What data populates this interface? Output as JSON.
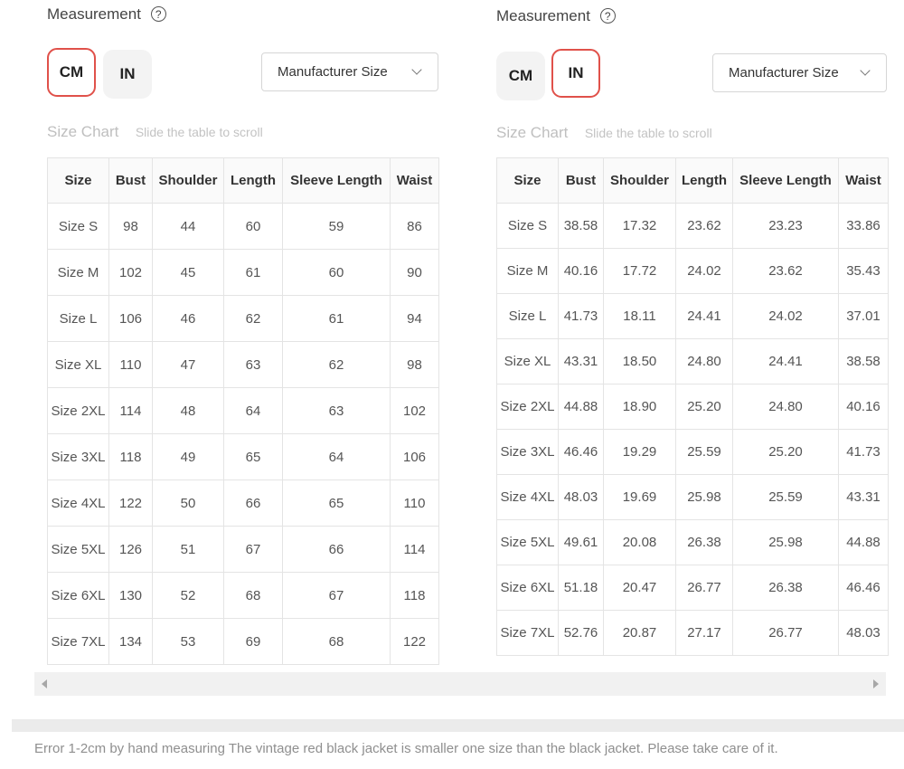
{
  "panels": [
    {
      "measurement_title": "Measurement",
      "help_icon": "?",
      "units": {
        "cm": "CM",
        "in": "IN",
        "active": "cm"
      },
      "size_select": "Manufacturer Size",
      "chart_title": "Size Chart",
      "chart_hint": "Slide the table to scroll",
      "headers": [
        "Size",
        "Bust",
        "Shoulder",
        "Length",
        "Sleeve Length",
        "Waist"
      ],
      "rows": [
        [
          "Size S",
          "98",
          "44",
          "60",
          "59",
          "86"
        ],
        [
          "Size M",
          "102",
          "45",
          "61",
          "60",
          "90"
        ],
        [
          "Size L",
          "106",
          "46",
          "62",
          "61",
          "94"
        ],
        [
          "Size XL",
          "110",
          "47",
          "63",
          "62",
          "98"
        ],
        [
          "Size 2XL",
          "114",
          "48",
          "64",
          "63",
          "102"
        ],
        [
          "Size 3XL",
          "118",
          "49",
          "65",
          "64",
          "106"
        ],
        [
          "Size 4XL",
          "122",
          "50",
          "66",
          "65",
          "110"
        ],
        [
          "Size 5XL",
          "126",
          "51",
          "67",
          "66",
          "114"
        ],
        [
          "Size 6XL",
          "130",
          "52",
          "68",
          "67",
          "118"
        ],
        [
          "Size 7XL",
          "134",
          "53",
          "69",
          "68",
          "122"
        ]
      ]
    },
    {
      "measurement_title": "Measurement",
      "help_icon": "?",
      "units": {
        "cm": "CM",
        "in": "IN",
        "active": "in"
      },
      "size_select": "Manufacturer Size",
      "chart_title": "Size Chart",
      "chart_hint": "Slide the table to scroll",
      "headers": [
        "Size",
        "Bust",
        "Shoulder",
        "Length",
        "Sleeve Length",
        "Waist"
      ],
      "rows": [
        [
          "Size S",
          "38.58",
          "17.32",
          "23.62",
          "23.23",
          "33.86"
        ],
        [
          "Size M",
          "40.16",
          "17.72",
          "24.02",
          "23.62",
          "35.43"
        ],
        [
          "Size L",
          "41.73",
          "18.11",
          "24.41",
          "24.02",
          "37.01"
        ],
        [
          "Size XL",
          "43.31",
          "18.50",
          "24.80",
          "24.41",
          "38.58"
        ],
        [
          "Size 2XL",
          "44.88",
          "18.90",
          "25.20",
          "24.80",
          "40.16"
        ],
        [
          "Size 3XL",
          "46.46",
          "19.29",
          "25.59",
          "25.20",
          "41.73"
        ],
        [
          "Size 4XL",
          "48.03",
          "19.69",
          "25.98",
          "25.59",
          "43.31"
        ],
        [
          "Size 5XL",
          "49.61",
          "20.08",
          "26.38",
          "25.98",
          "44.88"
        ],
        [
          "Size 6XL",
          "51.18",
          "20.47",
          "26.77",
          "26.38",
          "46.46"
        ],
        [
          "Size 7XL",
          "52.76",
          "20.87",
          "27.17",
          "26.77",
          "48.03"
        ]
      ]
    }
  ],
  "scrollbar": {
    "left_icon": "arrow-left-icon",
    "right_icon": "arrow-right-icon"
  },
  "note": "Error 1-2cm by hand measuring The vintage red black jacket is smaller one size than the black jacket. Please take care of it."
}
